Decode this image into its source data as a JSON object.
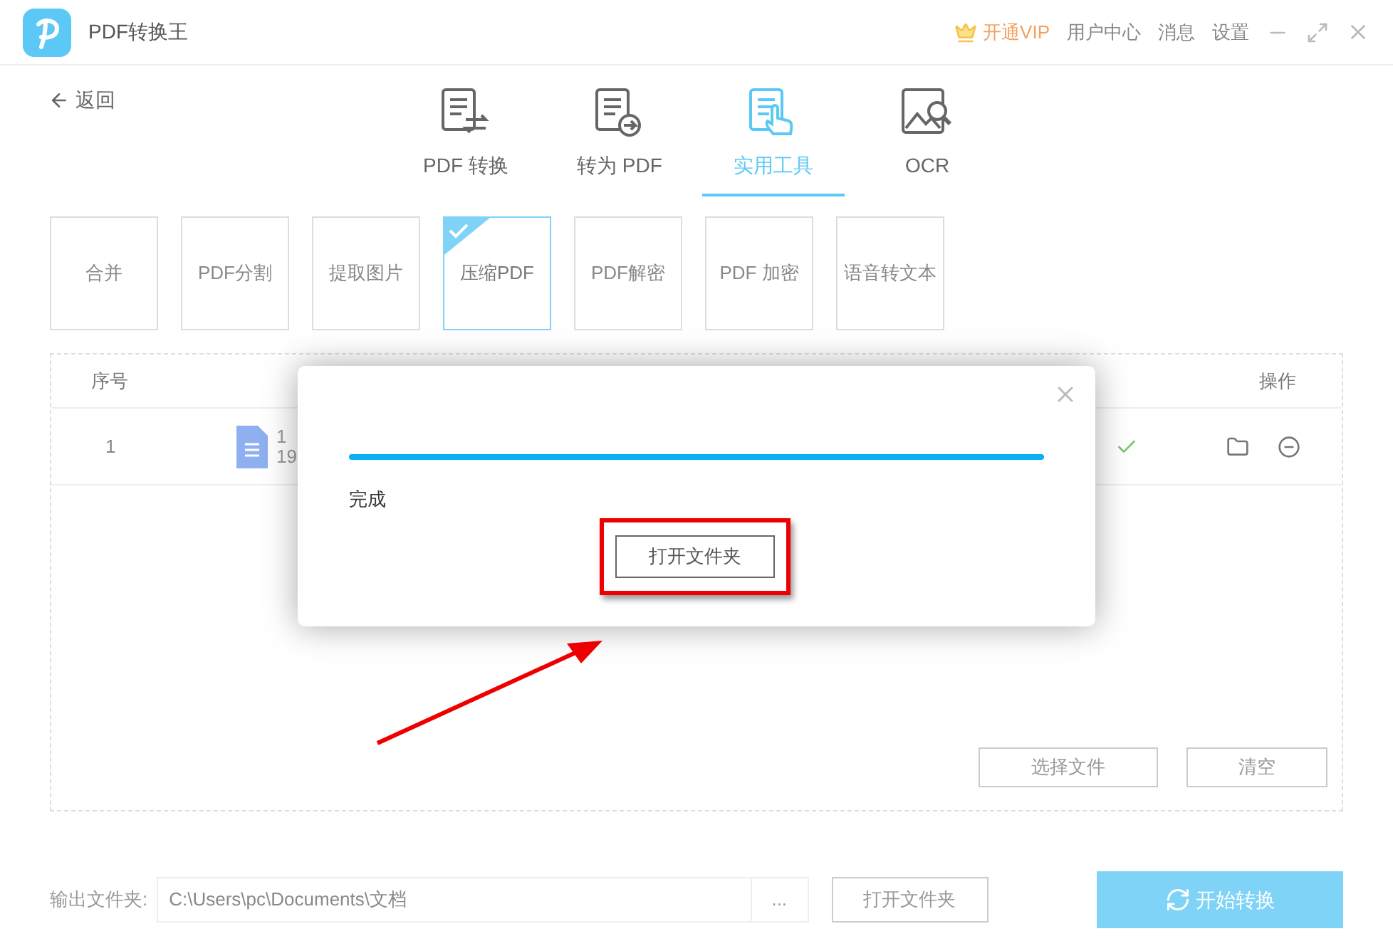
{
  "window": {
    "title": "PDF转换王",
    "vip": "开通VIP",
    "links": [
      "用户中心",
      "消息",
      "设置"
    ]
  },
  "back": "返回",
  "tabs": [
    {
      "label": "PDF 转换",
      "selected": false,
      "kind": "convert"
    },
    {
      "label": "转为 PDF",
      "selected": false,
      "kind": "topdf"
    },
    {
      "label": "实用工具",
      "selected": true,
      "kind": "tools"
    },
    {
      "label": "OCR",
      "selected": false,
      "kind": "ocr"
    }
  ],
  "tools": [
    {
      "label": "合并",
      "selected": false
    },
    {
      "label": "PDF分割",
      "selected": false
    },
    {
      "label": "提取图片",
      "selected": false
    },
    {
      "label": "压缩PDF",
      "selected": true
    },
    {
      "label": "PDF解密",
      "selected": false
    },
    {
      "label": "PDF 加密",
      "selected": false
    },
    {
      "label": "语音转文本",
      "selected": false
    }
  ],
  "table": {
    "columns": [
      "序号",
      "操作"
    ],
    "rows": [
      {
        "index": "1",
        "name": "1",
        "size": "19",
        "done": true
      }
    ]
  },
  "file_buttons": [
    "选择文件",
    "清空"
  ],
  "output": {
    "label": "输出文件夹:",
    "value": "C:\\Users\\pc\\Documents\\文档",
    "browse": "...",
    "open": "打开文件夹",
    "start": "开始转换"
  },
  "dialog": {
    "level": 1,
    "status": "完成",
    "button": "打开文件夹"
  }
}
